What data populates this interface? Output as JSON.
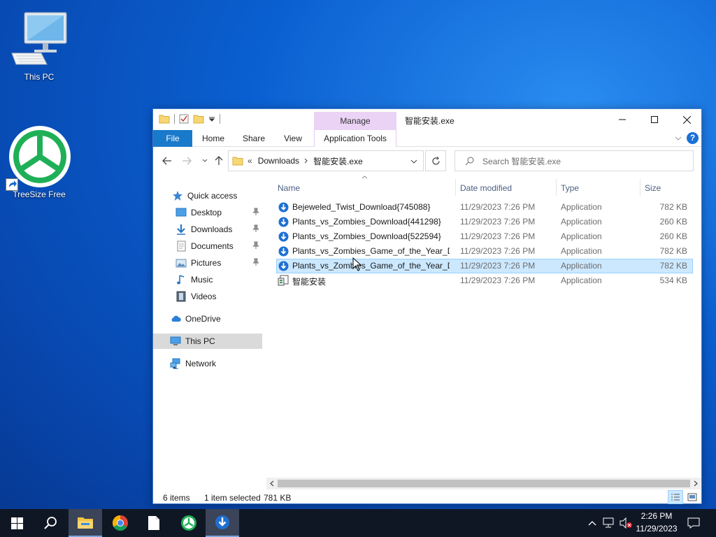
{
  "desktop": {
    "icons": [
      {
        "label": "This PC",
        "icon": "computer-icon"
      },
      {
        "label": "TreeSize Free",
        "icon": "treesize-icon"
      }
    ]
  },
  "window": {
    "title": "智能安装.exe",
    "manage_tab": "Manage",
    "ribbon_tabs": [
      "File",
      "Home",
      "Share",
      "View",
      "Application Tools"
    ],
    "address": {
      "chevron": "«",
      "segments": [
        "Downloads",
        "智能安装.exe"
      ]
    },
    "search_placeholder": "Search 智能安装.exe",
    "sidebar": [
      {
        "label": "Quick access",
        "icon": "star-icon",
        "pinned": false
      },
      {
        "label": "Desktop",
        "icon": "desktop-icon",
        "pinned": true
      },
      {
        "label": "Downloads",
        "icon": "download-arrow-icon",
        "pinned": true
      },
      {
        "label": "Documents",
        "icon": "documents-icon",
        "pinned": true
      },
      {
        "label": "Pictures",
        "icon": "pictures-icon",
        "pinned": true
      },
      {
        "label": "Music",
        "icon": "music-icon",
        "pinned": false
      },
      {
        "label": "Videos",
        "icon": "videos-icon",
        "pinned": false
      },
      {
        "label": "OneDrive",
        "icon": "cloud-icon",
        "pinned": false
      },
      {
        "label": "This PC",
        "icon": "computer-icon",
        "pinned": false,
        "selected": true
      },
      {
        "label": "Network",
        "icon": "network-icon",
        "pinned": false
      }
    ],
    "columns": [
      "Name",
      "Date modified",
      "Type",
      "Size"
    ],
    "files": [
      {
        "name": "Bejeweled_Twist_Download{745088}",
        "date": "11/29/2023 7:26 PM",
        "type": "Application",
        "size": "782 KB",
        "icon": "download-installer-icon"
      },
      {
        "name": "Plants_vs_Zombies_Download{441298}",
        "date": "11/29/2023 7:26 PM",
        "type": "Application",
        "size": "260 KB",
        "icon": "download-installer-icon"
      },
      {
        "name": "Plants_vs_Zombies_Download{522594}",
        "date": "11/29/2023 7:26 PM",
        "type": "Application",
        "size": "260 KB",
        "icon": "download-installer-icon"
      },
      {
        "name": "Plants_vs_Zombies_Game_of_the_Year_D...",
        "date": "11/29/2023 7:26 PM",
        "type": "Application",
        "size": "782 KB",
        "icon": "download-installer-icon"
      },
      {
        "name": "Plants_vs_Zombies_Game_of_the_Year_D...",
        "date": "11/29/2023 7:26 PM",
        "type": "Application",
        "size": "782 KB",
        "icon": "download-installer-icon",
        "selected": true
      },
      {
        "name": "智能安装",
        "date": "11/29/2023 7:26 PM",
        "type": "Application",
        "size": "534 KB",
        "icon": "installer-app-icon"
      }
    ],
    "status": {
      "items": "6 items",
      "selected": "1 item selected",
      "size": "781 KB"
    }
  },
  "taskbar": {
    "time": "2:26 PM",
    "date": "11/29/2023"
  },
  "colors": {
    "accent": "#1979ca",
    "selection": "#cce8ff",
    "manage_tab": "#ead3f5",
    "taskbar": "#101724"
  }
}
